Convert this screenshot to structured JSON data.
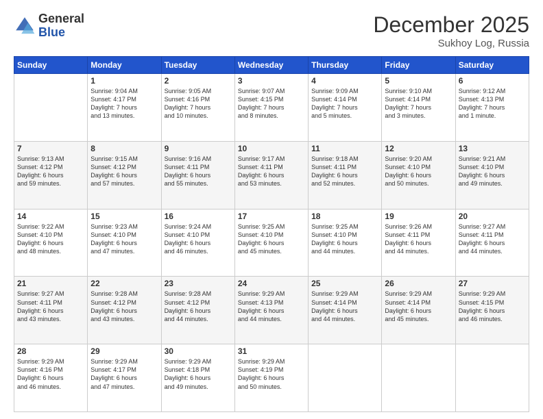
{
  "logo": {
    "general": "General",
    "blue": "Blue"
  },
  "header": {
    "month": "December 2025",
    "location": "Sukhoy Log, Russia"
  },
  "days_of_week": [
    "Sunday",
    "Monday",
    "Tuesday",
    "Wednesday",
    "Thursday",
    "Friday",
    "Saturday"
  ],
  "weeks": [
    [
      {
        "day": "",
        "info": ""
      },
      {
        "day": "1",
        "info": "Sunrise: 9:04 AM\nSunset: 4:17 PM\nDaylight: 7 hours\nand 13 minutes."
      },
      {
        "day": "2",
        "info": "Sunrise: 9:05 AM\nSunset: 4:16 PM\nDaylight: 7 hours\nand 10 minutes."
      },
      {
        "day": "3",
        "info": "Sunrise: 9:07 AM\nSunset: 4:15 PM\nDaylight: 7 hours\nand 8 minutes."
      },
      {
        "day": "4",
        "info": "Sunrise: 9:09 AM\nSunset: 4:14 PM\nDaylight: 7 hours\nand 5 minutes."
      },
      {
        "day": "5",
        "info": "Sunrise: 9:10 AM\nSunset: 4:14 PM\nDaylight: 7 hours\nand 3 minutes."
      },
      {
        "day": "6",
        "info": "Sunrise: 9:12 AM\nSunset: 4:13 PM\nDaylight: 7 hours\nand 1 minute."
      }
    ],
    [
      {
        "day": "7",
        "info": "Sunrise: 9:13 AM\nSunset: 4:12 PM\nDaylight: 6 hours\nand 59 minutes."
      },
      {
        "day": "8",
        "info": "Sunrise: 9:15 AM\nSunset: 4:12 PM\nDaylight: 6 hours\nand 57 minutes."
      },
      {
        "day": "9",
        "info": "Sunrise: 9:16 AM\nSunset: 4:11 PM\nDaylight: 6 hours\nand 55 minutes."
      },
      {
        "day": "10",
        "info": "Sunrise: 9:17 AM\nSunset: 4:11 PM\nDaylight: 6 hours\nand 53 minutes."
      },
      {
        "day": "11",
        "info": "Sunrise: 9:18 AM\nSunset: 4:11 PM\nDaylight: 6 hours\nand 52 minutes."
      },
      {
        "day": "12",
        "info": "Sunrise: 9:20 AM\nSunset: 4:10 PM\nDaylight: 6 hours\nand 50 minutes."
      },
      {
        "day": "13",
        "info": "Sunrise: 9:21 AM\nSunset: 4:10 PM\nDaylight: 6 hours\nand 49 minutes."
      }
    ],
    [
      {
        "day": "14",
        "info": "Sunrise: 9:22 AM\nSunset: 4:10 PM\nDaylight: 6 hours\nand 48 minutes."
      },
      {
        "day": "15",
        "info": "Sunrise: 9:23 AM\nSunset: 4:10 PM\nDaylight: 6 hours\nand 47 minutes."
      },
      {
        "day": "16",
        "info": "Sunrise: 9:24 AM\nSunset: 4:10 PM\nDaylight: 6 hours\nand 46 minutes."
      },
      {
        "day": "17",
        "info": "Sunrise: 9:25 AM\nSunset: 4:10 PM\nDaylight: 6 hours\nand 45 minutes."
      },
      {
        "day": "18",
        "info": "Sunrise: 9:25 AM\nSunset: 4:10 PM\nDaylight: 6 hours\nand 44 minutes."
      },
      {
        "day": "19",
        "info": "Sunrise: 9:26 AM\nSunset: 4:11 PM\nDaylight: 6 hours\nand 44 minutes."
      },
      {
        "day": "20",
        "info": "Sunrise: 9:27 AM\nSunset: 4:11 PM\nDaylight: 6 hours\nand 44 minutes."
      }
    ],
    [
      {
        "day": "21",
        "info": "Sunrise: 9:27 AM\nSunset: 4:11 PM\nDaylight: 6 hours\nand 43 minutes."
      },
      {
        "day": "22",
        "info": "Sunrise: 9:28 AM\nSunset: 4:12 PM\nDaylight: 6 hours\nand 43 minutes."
      },
      {
        "day": "23",
        "info": "Sunrise: 9:28 AM\nSunset: 4:12 PM\nDaylight: 6 hours\nand 44 minutes."
      },
      {
        "day": "24",
        "info": "Sunrise: 9:29 AM\nSunset: 4:13 PM\nDaylight: 6 hours\nand 44 minutes."
      },
      {
        "day": "25",
        "info": "Sunrise: 9:29 AM\nSunset: 4:14 PM\nDaylight: 6 hours\nand 44 minutes."
      },
      {
        "day": "26",
        "info": "Sunrise: 9:29 AM\nSunset: 4:14 PM\nDaylight: 6 hours\nand 45 minutes."
      },
      {
        "day": "27",
        "info": "Sunrise: 9:29 AM\nSunset: 4:15 PM\nDaylight: 6 hours\nand 46 minutes."
      }
    ],
    [
      {
        "day": "28",
        "info": "Sunrise: 9:29 AM\nSunset: 4:16 PM\nDaylight: 6 hours\nand 46 minutes."
      },
      {
        "day": "29",
        "info": "Sunrise: 9:29 AM\nSunset: 4:17 PM\nDaylight: 6 hours\nand 47 minutes."
      },
      {
        "day": "30",
        "info": "Sunrise: 9:29 AM\nSunset: 4:18 PM\nDaylight: 6 hours\nand 49 minutes."
      },
      {
        "day": "31",
        "info": "Sunrise: 9:29 AM\nSunset: 4:19 PM\nDaylight: 6 hours\nand 50 minutes."
      },
      {
        "day": "",
        "info": ""
      },
      {
        "day": "",
        "info": ""
      },
      {
        "day": "",
        "info": ""
      }
    ]
  ]
}
